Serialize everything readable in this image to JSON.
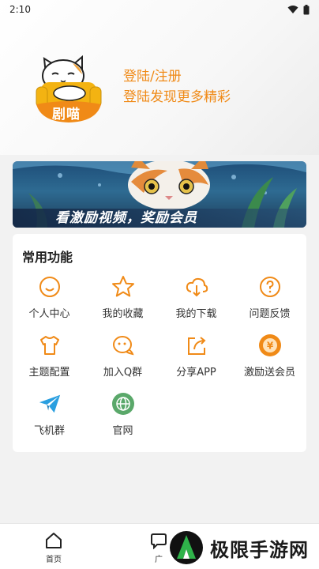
{
  "status_bar": {
    "time": "2:10",
    "icons": [
      "wifi-icon",
      "battery-icon"
    ]
  },
  "profile": {
    "logo_text": "剧喵",
    "login_label": "登陆/注册",
    "subtitle": "登陆发现更多精彩"
  },
  "banner": {
    "caption": "看激励视频，奖励会员"
  },
  "features": {
    "title": "常用功能",
    "items": [
      {
        "label": "个人中心",
        "icon": "smile-icon"
      },
      {
        "label": "我的收藏",
        "icon": "star-icon"
      },
      {
        "label": "我的下载",
        "icon": "cloud-download-icon"
      },
      {
        "label": "问题反馈",
        "icon": "question-icon"
      },
      {
        "label": "主题配置",
        "icon": "tshirt-icon"
      },
      {
        "label": "加入Q群",
        "icon": "chat-icon"
      },
      {
        "label": "分享APP",
        "icon": "share-icon"
      },
      {
        "label": "激励送会员",
        "icon": "coin-icon"
      },
      {
        "label": "飞机群",
        "icon": "telegram-icon"
      },
      {
        "label": "官网",
        "icon": "globe-icon"
      }
    ]
  },
  "bottom_nav": {
    "home_label": "首页",
    "second_label": "广"
  },
  "watermark": {
    "text": "极限手游网"
  },
  "colors": {
    "accent": "#f08a17",
    "telegram": "#2a9fe0",
    "globe": "#5aa86a"
  }
}
